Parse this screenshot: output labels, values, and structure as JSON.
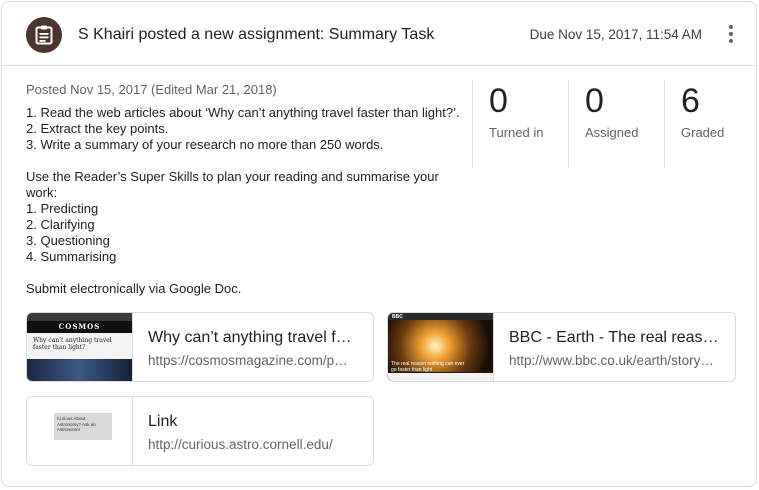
{
  "header": {
    "title": "S Khairi posted a new assignment: Summary Task",
    "due": "Due Nov 15, 2017, 11:54 AM",
    "avatar_color": "#4e342e",
    "avatar_icon": "assignment-icon"
  },
  "posted": "Posted Nov 15, 2017 (Edited Mar 21, 2018)",
  "body_lines": [
    "1. Read the web articles about ‘Why can’t anything travel faster than light?’.",
    "2. Extract the key points.",
    "3. Write a summary of your research no more than 250 words.",
    "",
    "Use the Reader’s Super Skills to plan your reading and summarise your",
    "work:",
    "1. Predicting",
    "2. Clarifying",
    "3. Questioning",
    "4. Summarising",
    "",
    "Submit electronically via Google Doc."
  ],
  "stats": [
    {
      "value": "0",
      "label": "Turned in"
    },
    {
      "value": "0",
      "label": "Assigned"
    },
    {
      "value": "6",
      "label": "Graded"
    }
  ],
  "attachments": [
    {
      "title": "Why can’t anything travel faster than light?",
      "url": "https://cosmosmagazine.com/physics/why-cant-anything-travel-faster-than-light",
      "thumb_brand": "COSMOS",
      "thumb_headline": "Why can’t anything travel faster than light?"
    },
    {
      "title": "BBC - Earth - The real reason nothing can ever go faster than light",
      "url": "http://www.bbc.co.uk/earth/story/the-real-reason-nothing",
      "thumb_brand": "BBC",
      "thumb_headline": "The real reason nothing can ever go faster than light"
    },
    {
      "title": "Link",
      "url": "http://curious.astro.cornell.edu/",
      "thumb_headline": "Curious About Astronomy? Ask an Astronomer"
    }
  ]
}
